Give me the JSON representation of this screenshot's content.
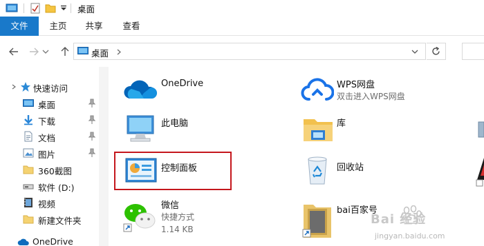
{
  "window": {
    "title": "桌面"
  },
  "ribbon": {
    "tabs": [
      {
        "label": "文件"
      },
      {
        "label": "主页"
      },
      {
        "label": "共享"
      },
      {
        "label": "查看"
      }
    ]
  },
  "address": {
    "path": "桌面"
  },
  "sidebar": {
    "items": [
      {
        "label": "快速访问",
        "icon": "star-icon"
      },
      {
        "label": "桌面",
        "icon": "desktop-icon",
        "pinned": true
      },
      {
        "label": "下载",
        "icon": "download-icon",
        "pinned": true
      },
      {
        "label": "文档",
        "icon": "document-icon",
        "pinned": true
      },
      {
        "label": "图片",
        "icon": "picture-icon",
        "pinned": true
      },
      {
        "label": "360截图",
        "icon": "folder-icon"
      },
      {
        "label": "软件 (D:)",
        "icon": "drive-icon"
      },
      {
        "label": "视频",
        "icon": "video-icon"
      },
      {
        "label": "新建文件夹",
        "icon": "folder-icon"
      },
      {
        "label": "OneDrive",
        "icon": "onedrive-icon"
      }
    ]
  },
  "content": {
    "items": [
      {
        "name": "OneDrive",
        "sub": "",
        "icon": "onedrive-icon"
      },
      {
        "name": "WPS网盘",
        "sub": "双击进入WPS网盘",
        "icon": "wps-cloud-icon"
      },
      {
        "name": "此电脑",
        "sub": "",
        "icon": "computer-icon"
      },
      {
        "name": "库",
        "sub": "",
        "icon": "library-icon"
      },
      {
        "name": "控制面板",
        "sub": "",
        "icon": "control-panel-icon"
      },
      {
        "name": "回收站",
        "sub": "",
        "icon": "recycle-bin-icon"
      },
      {
        "name": "微信",
        "sub": "快捷方式",
        "sub2": "1.14 KB",
        "icon": "wechat-icon"
      },
      {
        "name": "bai百家号",
        "sub": "",
        "icon": "baijiahao-icon"
      }
    ]
  },
  "watermark": {
    "line1": "Bai 经验",
    "line2": "jingyan.baidu.com"
  },
  "colors": {
    "accent": "#1979ca",
    "highlight": "#c4161c"
  }
}
